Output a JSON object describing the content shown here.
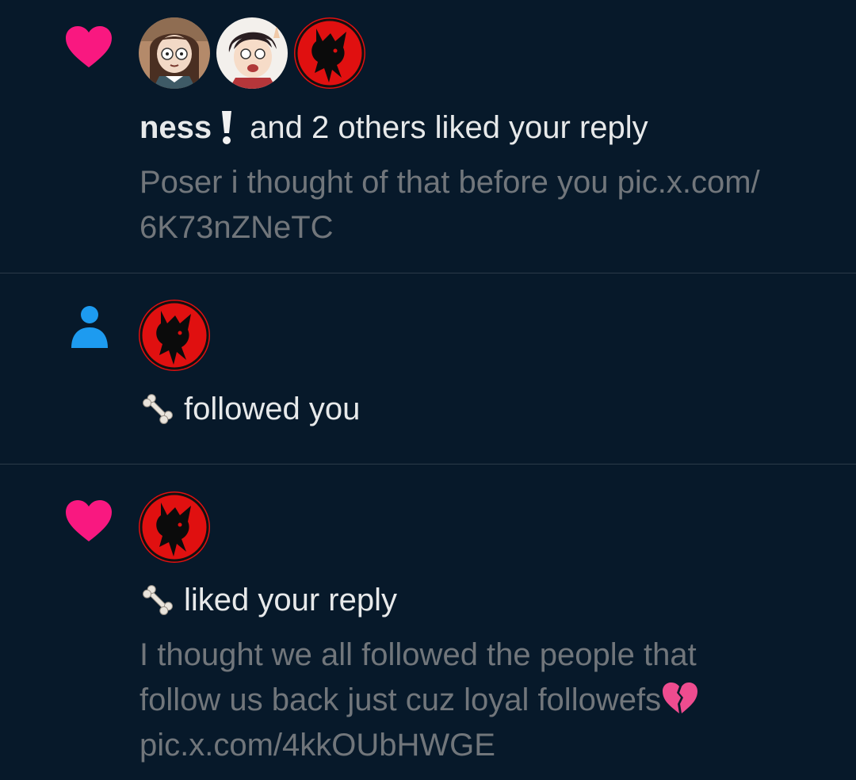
{
  "notifications": [
    {
      "type": "like",
      "type_icon": "heart-icon",
      "avatars": [
        "avatar-girl",
        "avatar-boy",
        "avatar-red-silhouette"
      ],
      "actor_name": "ness",
      "actor_emoji": "❕",
      "action": "and 2 others liked your reply",
      "body_lines": [
        "Poser i thought of that before you pic.x.com/",
        "6K73nZNeTC"
      ]
    },
    {
      "type": "follow",
      "type_icon": "person-icon",
      "avatars": [
        "avatar-red-silhouette"
      ],
      "actor_emoji": "bone-emoji",
      "action": "followed you"
    },
    {
      "type": "like",
      "type_icon": "heart-icon",
      "avatars": [
        "avatar-red-silhouette"
      ],
      "actor_emoji": "bone-emoji",
      "action": "liked your reply",
      "body_lines": [
        "I thought we all followed the people that",
        "follow us back  just cuz loyal followefs",
        "pic.x.com/4kkOUbHWGE"
      ],
      "body_emoji": "💔"
    }
  ],
  "colors": {
    "background": "#07192a",
    "heart": "#f91880",
    "follow_icon": "#1d9bf0",
    "primary_text": "#e7e9ea",
    "secondary_text": "#71767b",
    "divider": "#2b3a48"
  }
}
